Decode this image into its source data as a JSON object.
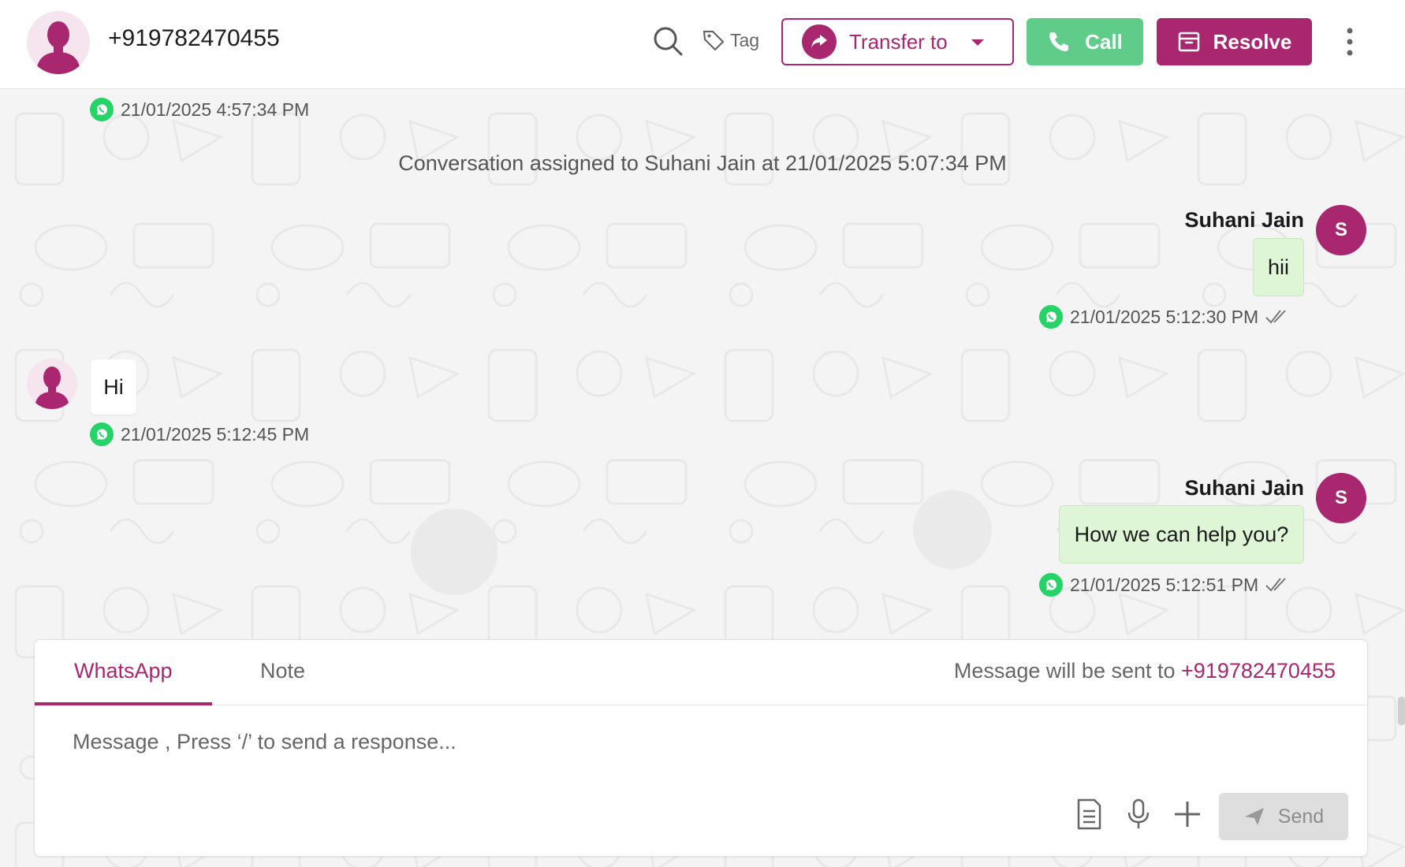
{
  "header": {
    "contact_number": "+919782470455",
    "tag_label": "Tag",
    "transfer_label": "Transfer to",
    "call_label": "Call",
    "resolve_label": "Resolve"
  },
  "chat": {
    "messages": [
      {
        "direction": "in",
        "text": "",
        "timestamp": "21/01/2025 4:57:34 PM"
      },
      {
        "type": "system",
        "text": "Conversation assigned to Suhani Jain at 21/01/2025 5:07:34 PM"
      },
      {
        "direction": "out",
        "sender": "Suhani Jain",
        "avatar_initial": "S",
        "text": "hii",
        "timestamp": "21/01/2025 5:12:30 PM"
      },
      {
        "direction": "in",
        "text": "Hi",
        "timestamp": "21/01/2025 5:12:45 PM"
      },
      {
        "direction": "out",
        "sender": "Suhani Jain",
        "avatar_initial": "S",
        "text": "How we can help you?",
        "timestamp": "21/01/2025 5:12:51 PM"
      }
    ]
  },
  "composer": {
    "tabs": [
      {
        "label": "WhatsApp",
        "active": true
      },
      {
        "label": "Note",
        "active": false
      }
    ],
    "send_info_prefix": "Message will be sent to",
    "send_info_number": "+919782470455",
    "placeholder": "Message , Press ‘/’ to send a response...",
    "send_label": "Send"
  },
  "colors": {
    "brand": "#a8276f",
    "call_green": "#5fcc8a",
    "whatsapp_green": "#25d366",
    "outgoing_bubble": "#dff6d6"
  },
  "icons": [
    "search-icon",
    "tag-icon",
    "transfer-icon",
    "phone-icon",
    "archive-icon",
    "more-vertical-icon",
    "whatsapp-icon",
    "double-check-icon",
    "template-icon",
    "microphone-icon",
    "plus-icon",
    "send-icon"
  ]
}
